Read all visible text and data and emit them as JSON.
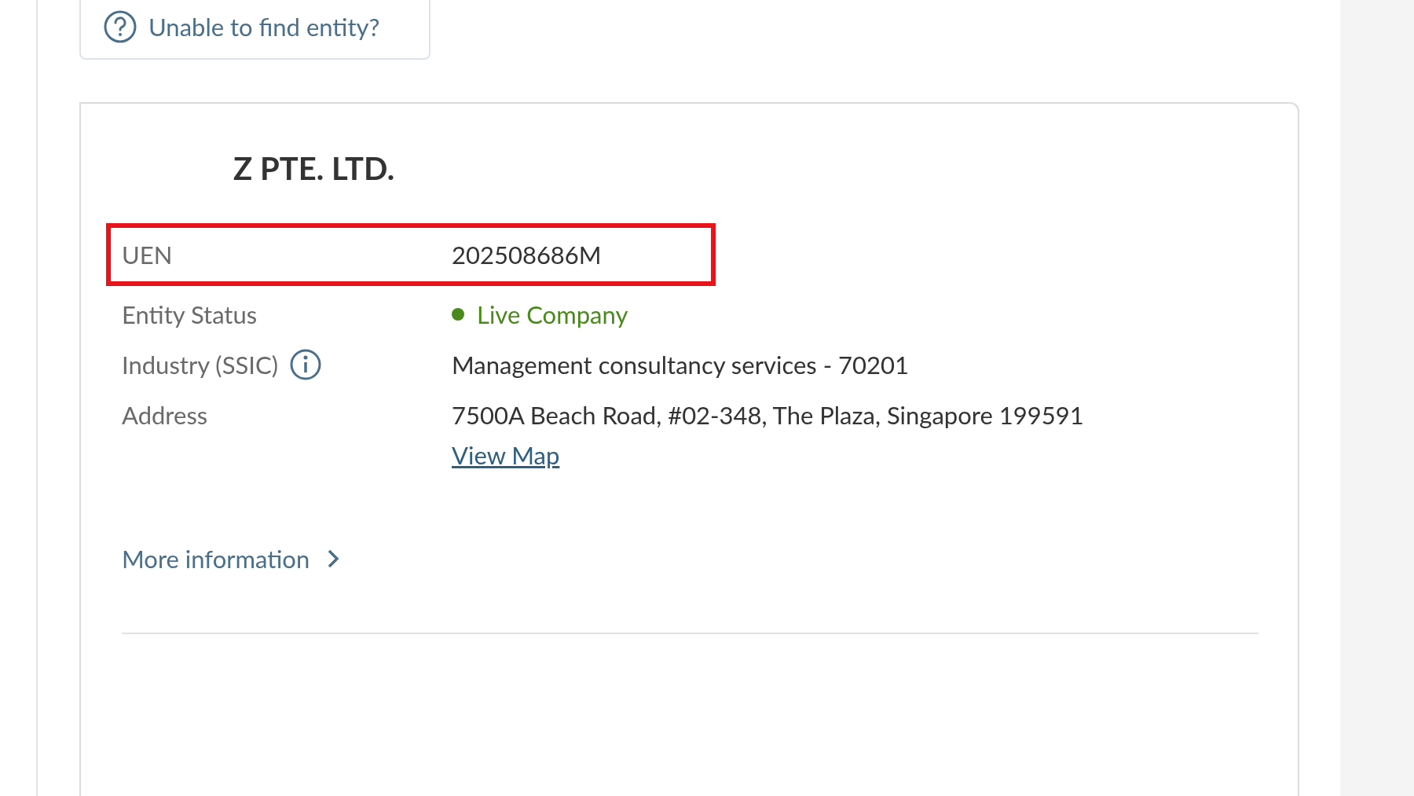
{
  "help_link": {
    "label": "Unable to find entity?"
  },
  "entity": {
    "name": "Z PTE. LTD.",
    "fields": [
      {
        "kind": "plain",
        "label": "UEN",
        "value": "202508686M",
        "highlighted": true
      },
      {
        "kind": "status",
        "label": "Entity Status",
        "value": "Live Company",
        "color": "#4a8a1c",
        "highlighted": false
      },
      {
        "kind": "info",
        "label": "Industry (SSIC)",
        "value": "Management consultancy services - 70201",
        "highlighted": false
      },
      {
        "kind": "address",
        "label": "Address",
        "value": "7500A Beach Road, #02-348, The Plaza, Singapore 199591",
        "link": "View Map",
        "highlighted": false
      }
    ],
    "more_link": "More information"
  }
}
